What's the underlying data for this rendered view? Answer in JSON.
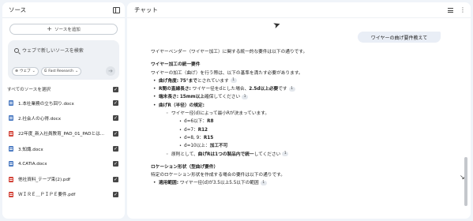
{
  "sources_panel": {
    "title": "ソース",
    "add_source_label": "ソースを追加",
    "search_placeholder": "ウェブで新しいソースを検索",
    "chip_web": "ウェブ",
    "chip_research": "Fast Research",
    "select_all_label": "すべてのソースを選択",
    "items": [
      {
        "name": "1.本社業務の立ち回り.docx",
        "type": "doc",
        "checked": true
      },
      {
        "name": "2.社会人の心得.docx",
        "type": "doc",
        "checked": true
      },
      {
        "name": "22年度_新入社員教育_PAD_01_PADとは...",
        "type": "pdf",
        "checked": true
      },
      {
        "name": "3.知識.docx",
        "type": "doc",
        "checked": true
      },
      {
        "name": "4.CATIA.docx",
        "type": "doc",
        "checked": true
      },
      {
        "name": "他社資料_テープ束(2).pdf",
        "type": "pdf",
        "checked": true
      },
      {
        "name": "ＷＩＲＥ＿ＰＩＰＥ要件.pdf",
        "type": "pdf",
        "checked": true
      }
    ]
  },
  "chat_panel": {
    "title": "チャット",
    "user_message": "ワイヤーの曲げ要件教えて",
    "answer": {
      "intro": "ワイヤーベンダー（ワイヤー加工）に関する統一的な要件は以下の通りです。",
      "section1_title": "ワイヤー加工の統一要件",
      "section1_text": "ワイヤーの加工（曲げ）を行う際は、以下の基準を満たす必要があります。",
      "b1_label": "曲げ角度:",
      "b1_value": "75°まで",
      "b1_rest": "とされています",
      "b2_label": "R間の直線長さ:",
      "b2_text": "ワイヤー径をdとした場合、",
      "b2_value": "2.5d以上必要",
      "b2_rest": "です",
      "b3_label": "端末長さ:",
      "b3_value": "15mm以上",
      "b3_rest": "確保してください",
      "b4_label": "曲げR（半径）の規定:",
      "b4_sub": "ワイヤー径(d)によって最小Rが決まっています。",
      "r_rules": [
        {
          "cond": "d=6以下：",
          "val": "R8"
        },
        {
          "cond": "d=7：",
          "val": "R12"
        },
        {
          "cond": "d=8, 9：",
          "val": "R15"
        },
        {
          "cond": "d=10以上：",
          "val": "加工不可"
        }
      ],
      "b4_note_pre": "原則として、",
      "b4_note_bold": "曲げRは1つの製品内で統一",
      "b4_note_post": "してください",
      "section2_title": "ロケーション形状（型曲げ要件）",
      "section2_text": "特定のロケーション形状を作成する場合の要件は以下の通りです。",
      "b5_label": "適用範囲:",
      "b5_text": "ワイヤー径(d)が3.5以上5.5以下の範囲",
      "cite": "1"
    }
  }
}
